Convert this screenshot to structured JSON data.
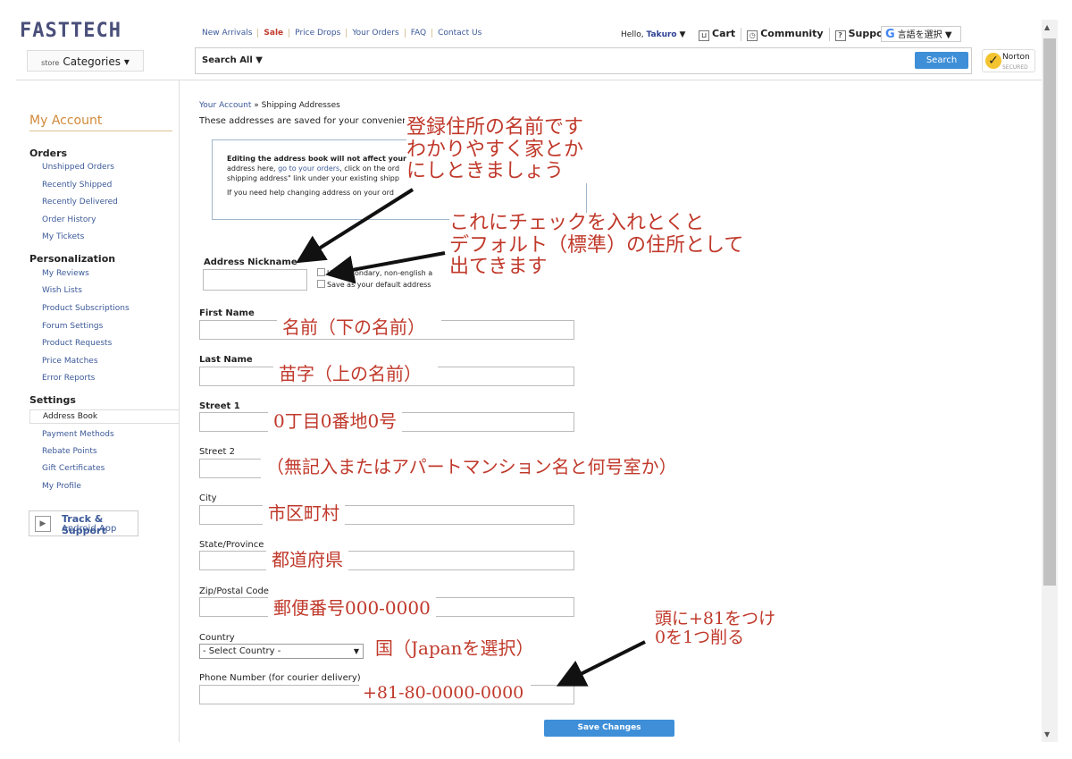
{
  "header": {
    "logo": "FASTTECH",
    "nav": [
      "New Arrivals",
      "Sale",
      "Price Drops",
      "Your Orders",
      "FAQ",
      "Contact Us"
    ],
    "hello_prefix": "Hello, ",
    "user": "Takuro",
    "hello_caret": " ▼",
    "cart": "Cart",
    "community": "Community",
    "support": "Support",
    "language": "言語を選択",
    "store_label": "store",
    "categories": "Categories ▾",
    "search_scope": "Search All ▼",
    "search_button": "Search",
    "norton": "Norton",
    "norton_sub": "SECURED"
  },
  "sidebar": {
    "title": "My Account",
    "sections": [
      {
        "heading": "Orders",
        "items": [
          "Unshipped Orders",
          "Recently Shipped",
          "Recently Delivered",
          "Order History",
          "My Tickets"
        ]
      },
      {
        "heading": "Personalization",
        "items": [
          "My Reviews",
          "Wish Lists",
          "Product Subscriptions",
          "Forum Settings",
          "Product Requests",
          "Price Matches",
          "Error Reports"
        ]
      },
      {
        "heading": "Settings",
        "items": [
          "Address Book",
          "Payment Methods",
          "Rebate Points",
          "Gift Certificates",
          "My Profile"
        ]
      }
    ],
    "app_title": "Track & Support",
    "app_sub": "Android App"
  },
  "main": {
    "breadcrumb_1": "Your Account",
    "breadcrumb_sep": " » ",
    "breadcrumb_2": "Shipping Addresses",
    "intro": "These addresses are saved for your convenienc",
    "notice": {
      "line1": "Editing the address book will not affect your",
      "line2_pre": "address here, ",
      "line2_link": "go to your orders",
      "line2_post": ", click on the ord",
      "line3": "shipping address\" link under your existing shipp",
      "line4": "If you need help changing address on your ord"
    },
    "labels": {
      "nickname": "Address Nickname",
      "first_name": "First Name",
      "last_name": "Last Name",
      "street1": "Street 1",
      "street2": "Street 2",
      "city": "City",
      "state": "State/Province",
      "zip": "Zip/Postal Code",
      "country": "Country",
      "phone": "Phone Number (for courier delivery)"
    },
    "checkbox_secondary": "Use secondary, non-english a",
    "checkbox_default": "Save as your default address",
    "country_value": "- Select Country -",
    "save_button": "Save Changes"
  },
  "annotations": {
    "nickname_note": "登録住所の名前です\nわかりやすく家とか\nにしときましょう",
    "default_note": "これにチェックを入れとくと\nデフォルト（標準）の住所として\n出てきます",
    "first_name": "名前（下の名前）",
    "last_name": "苗字（上の名前）",
    "street1": "0丁目0番地0号",
    "street2": "（無記入またはアパートマンション名と何号室か）",
    "city": "市区町村",
    "state": "都道府県",
    "zip": "郵便番号000-0000",
    "country": "国（Japanを選択）",
    "phone_note": "頭に+81をつけ\n0を1つ削る",
    "phone_example": "+81-80-0000-0000"
  },
  "colors": {
    "annotation": "#c0392b",
    "link": "#3b5998",
    "button": "#3f8fd8",
    "accent": "#d08a3a"
  }
}
